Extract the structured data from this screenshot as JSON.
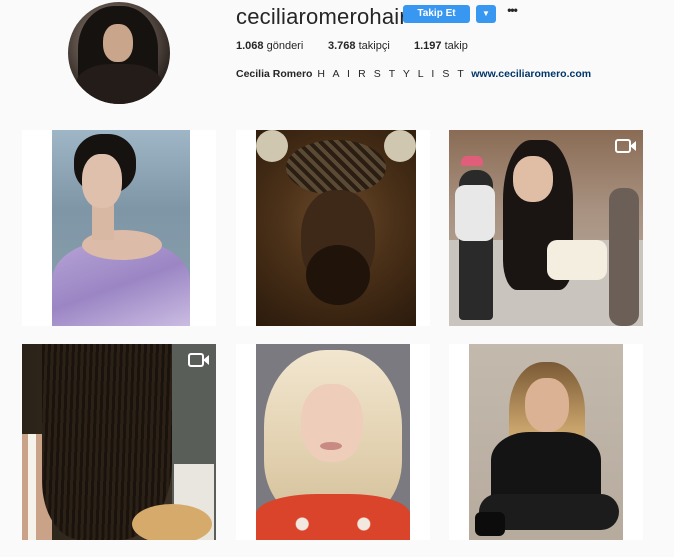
{
  "profile": {
    "username": "ceciliaromerohair",
    "follow_label": "Takip Et",
    "stats": {
      "posts_value": "1.068",
      "posts_label": "gönderi",
      "followers_value": "3.768",
      "followers_label": "takipçi",
      "following_value": "1.197",
      "following_label": "takip"
    },
    "bio": {
      "name": "Cecilia Romero",
      "tagline": "H A I R S T Y L I S T",
      "link": "www.ceciliaromero.com"
    }
  },
  "icons": {
    "more": "more-options-icon",
    "dropdown": "chevron-down-icon",
    "video": "video-camera-icon"
  },
  "colors": {
    "accent": "#3897f0",
    "link": "#003569",
    "background": "#fafafa"
  }
}
